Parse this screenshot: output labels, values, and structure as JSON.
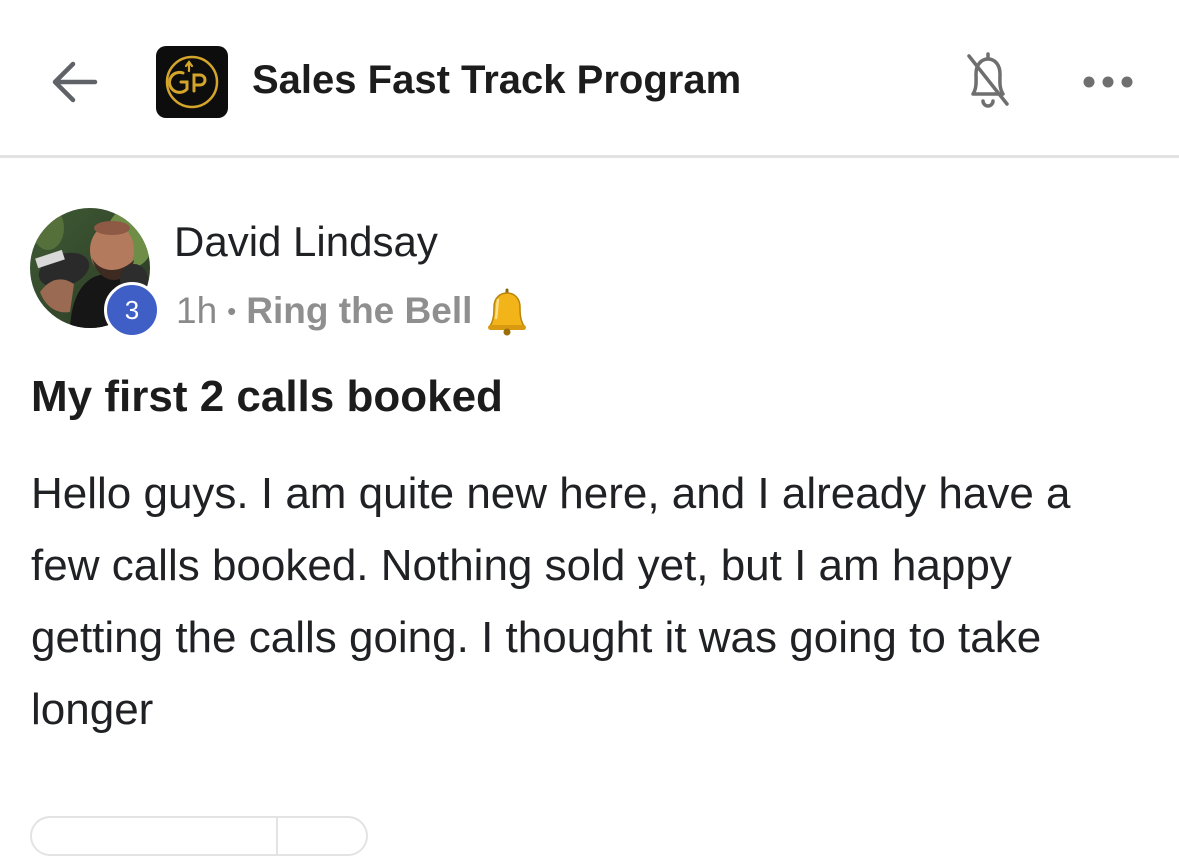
{
  "header": {
    "back_icon": "arrow-left-icon",
    "group_logo_icon": "gp-logo-icon",
    "group_name": "Sales Fast Track Program",
    "mute_icon": "bell-off-icon",
    "more_icon": "more-horizontal-icon"
  },
  "post": {
    "author": {
      "name": "David Lindsay",
      "level": "3",
      "level_color": "#3f5ec6"
    },
    "time_ago": "1h",
    "separator": "•",
    "category": "Ring the Bell",
    "category_emoji": "bell-emoji",
    "title": "My first 2 calls booked",
    "body": "Hello guys. I am quite new here, and I already have a few calls booked. Nothing sold yet, but I am happy getting the calls going. I thought it was going to take longer"
  },
  "colors": {
    "logo_bg": "#0d0d0d",
    "logo_gold": "#d4a52a",
    "divider": "#e3e3e3",
    "meta_text": "#8a8a8a"
  }
}
